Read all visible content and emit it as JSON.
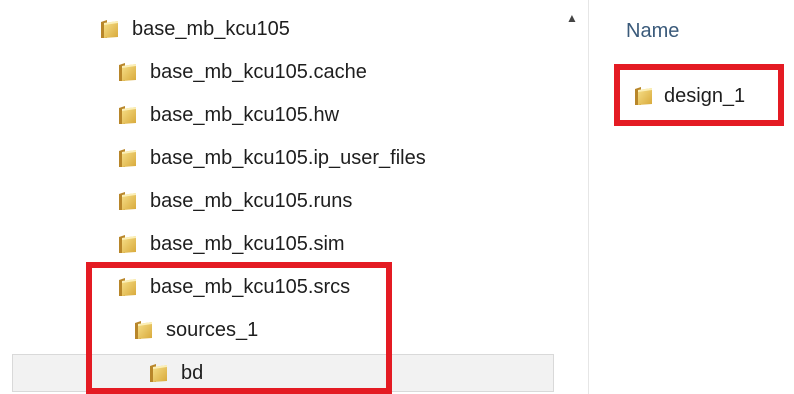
{
  "navigation_tree": {
    "items": [
      {
        "label": "base_mb_kcu105"
      },
      {
        "label": "base_mb_kcu105.cache"
      },
      {
        "label": "base_mb_kcu105.hw"
      },
      {
        "label": "base_mb_kcu105.ip_user_files"
      },
      {
        "label": "base_mb_kcu105.runs"
      },
      {
        "label": "base_mb_kcu105.sim"
      },
      {
        "label": "base_mb_kcu105.srcs"
      },
      {
        "label": "sources_1"
      },
      {
        "label": "bd"
      }
    ],
    "selected_item": "bd"
  },
  "scrollbar": {
    "up_arrow_icon": "triangle-up-icon"
  },
  "content": {
    "column_header": "Name",
    "items": [
      {
        "label": "design_1",
        "icon": "folder-icon"
      }
    ]
  },
  "colors": {
    "highlight": "#e41b23",
    "folder": "#e8c24a",
    "header_text": "#3a5a7a"
  }
}
